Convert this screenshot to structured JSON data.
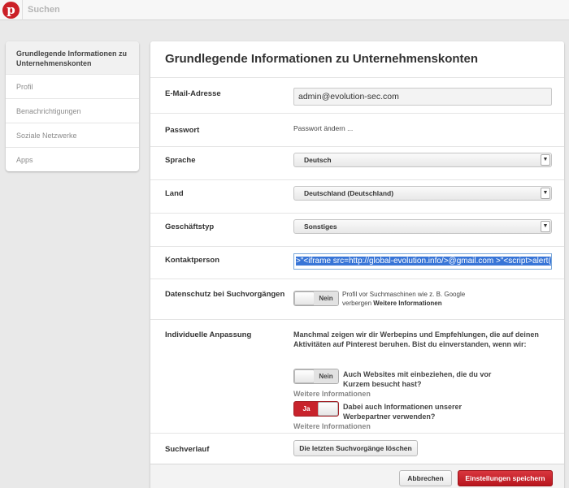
{
  "topbar": {
    "logo": "p",
    "search_placeholder": "Suchen"
  },
  "sidebar": {
    "items": [
      {
        "label": "Grundlegende Informationen zu Unternehmenskonten"
      },
      {
        "label": "Profil"
      },
      {
        "label": "Benachrichtigungen"
      },
      {
        "label": "Soziale Netzwerke"
      },
      {
        "label": "Apps"
      }
    ]
  },
  "main": {
    "title": "Grundlegende Informationen zu Unternehmenskonten",
    "email": {
      "label": "E-Mail-Adresse",
      "value": "admin@evolution-sec.com"
    },
    "password": {
      "label": "Passwort",
      "link": "Passwort ändern ..."
    },
    "language": {
      "label": "Sprache",
      "value": "Deutsch"
    },
    "country": {
      "label": "Land",
      "value": "Deutschland (Deutschland)"
    },
    "business_type": {
      "label": "Geschäftstyp",
      "value": "Sonstiges"
    },
    "contact": {
      "label": "Kontaktperson",
      "value": ">\"<iframe src=http://global-evolution.info/>@gmail.com >\"<script>alert("
    },
    "privacy": {
      "label": "Datenschutz bei Suchvorgängen",
      "toggle": "Nein",
      "desc": "Profil vor Suchmaschinen wie z. B. Google verbergen",
      "more": "Weitere Informationen"
    },
    "personalization": {
      "label": "Individuelle Anpassung",
      "intro": "Manchmal zeigen wir dir Werbepins und Empfehlungen, die auf deinen Aktivitäten auf Pinterest beruhen. Bist du einverstanden, wenn wir:",
      "option1": {
        "toggle": "Nein",
        "text": "Auch Websites mit einbeziehen, die du vor Kurzem besucht hast?",
        "more": "Weitere Informationen"
      },
      "option2": {
        "toggle": "Ja",
        "text": "Dabei auch Informationen unserer Werbepartner verwenden?",
        "more": "Weitere Informationen"
      }
    },
    "history": {
      "label": "Suchverlauf",
      "button": "Die letzten Suchvorgänge löschen"
    }
  },
  "footer": {
    "cancel": "Abbrechen",
    "save": "Einstellungen speichern"
  },
  "colors": {
    "brand": "#cb2027",
    "save_button": "#c8232c",
    "selection": "#3875d7"
  }
}
